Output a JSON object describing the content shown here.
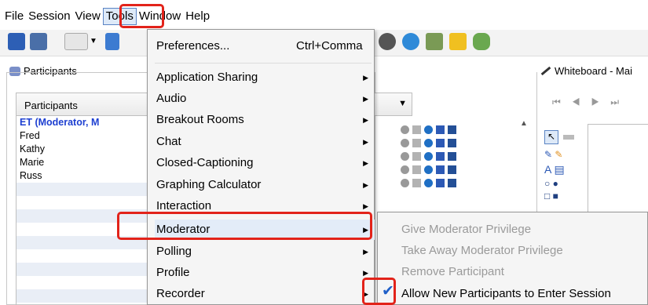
{
  "menubar": {
    "items": [
      "File",
      "Session",
      "View",
      "Tools",
      "Window",
      "Help"
    ]
  },
  "panels": {
    "participants_title": "Participants",
    "whiteboard_title": "Whiteboard - Mai"
  },
  "participants": {
    "header": "Participants",
    "rows": [
      {
        "name": "ET (Moderator, M",
        "moderator": true
      },
      {
        "name": "Fred",
        "moderator": false
      },
      {
        "name": "Kathy",
        "moderator": false
      },
      {
        "name": "Marie",
        "moderator": false
      },
      {
        "name": "Russ",
        "moderator": false
      }
    ]
  },
  "tools_menu": {
    "items": [
      {
        "label": "Preferences...",
        "shortcut": "Ctrl+Comma",
        "submenu": false
      },
      {
        "label": "Application Sharing",
        "shortcut": "",
        "submenu": true
      },
      {
        "label": "Audio",
        "shortcut": "",
        "submenu": true
      },
      {
        "label": "Breakout Rooms",
        "shortcut": "",
        "submenu": true
      },
      {
        "label": "Chat",
        "shortcut": "",
        "submenu": true
      },
      {
        "label": "Closed-Captioning",
        "shortcut": "",
        "submenu": true
      },
      {
        "label": "Graphing Calculator",
        "shortcut": "",
        "submenu": true
      },
      {
        "label": "Interaction",
        "shortcut": "",
        "submenu": true
      },
      {
        "label": "Moderator",
        "shortcut": "",
        "submenu": true,
        "highlighted": true
      },
      {
        "label": "Polling",
        "shortcut": "",
        "submenu": true
      },
      {
        "label": "Profile",
        "shortcut": "",
        "submenu": true
      },
      {
        "label": "Recorder",
        "shortcut": "",
        "submenu": true
      }
    ]
  },
  "moderator_submenu": {
    "items": [
      {
        "label": "Give Moderator Privilege",
        "enabled": false,
        "checked": false
      },
      {
        "label": "Take Away Moderator Privilege",
        "enabled": false,
        "checked": false
      },
      {
        "label": "Remove Participant",
        "enabled": false,
        "checked": false
      },
      {
        "label": "Allow New Participants to Enter Session",
        "enabled": true,
        "checked": true
      }
    ]
  },
  "colors": {
    "highlight_outline": "#e2231a",
    "moderator_text": "#1d3fd1",
    "check": "#1f5fc8"
  }
}
